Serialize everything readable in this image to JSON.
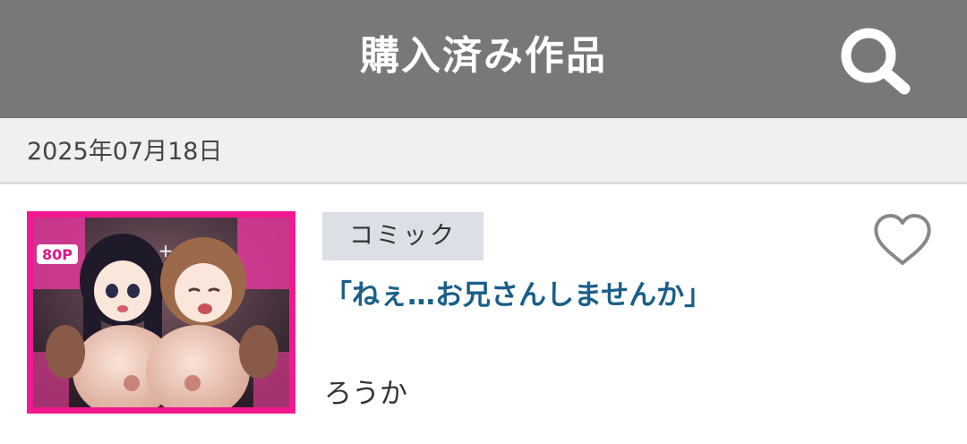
{
  "header": {
    "title": "購入済み作品",
    "search_icon": "search-icon",
    "background": "#787878"
  },
  "date_group": {
    "date": "2025年07月18日"
  },
  "items": [
    {
      "category": "コミック",
      "title": "「ねぇ…お兄さんしませんか」",
      "circle": "ろうか",
      "title_color": "#1a5f87",
      "thumbnail_border": "#f0198f",
      "favorite_icon": "heart-outline-icon",
      "thumbnail_texts": [
        "80P",
        "+"
      ]
    }
  ]
}
